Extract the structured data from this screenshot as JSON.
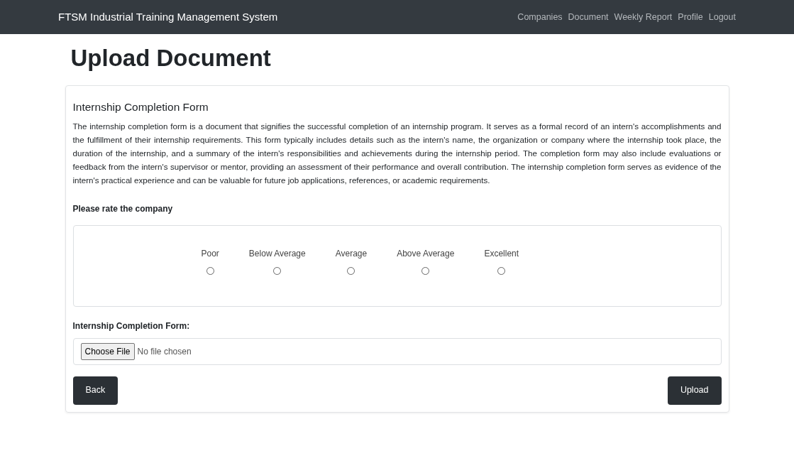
{
  "navbar": {
    "brand": "FTSM Industrial Training Management System",
    "links": [
      {
        "label": "Companies"
      },
      {
        "label": "Document"
      },
      {
        "label": "Weekly Report"
      },
      {
        "label": "Profile"
      },
      {
        "label": "Logout"
      }
    ]
  },
  "page_title": "Upload Document",
  "form": {
    "title": "Internship Completion Form",
    "description": "The internship completion form is a document that signifies the successful completion of an internship program. It serves as a formal record of an intern's accomplishments and the fulfillment of their internship requirements. This form typically includes details such as the intern's name, the organization or company where the internship took place, the duration of the internship, and a summary of the intern's responsibilities and achievements during the internship period. The completion form may also include evaluations or feedback from the intern's supervisor or mentor, providing an assessment of their performance and overall contribution. The internship completion form serves as evidence of the intern's practical experience and can be valuable for future job applications, references, or academic requirements.",
    "rating_label": "Please rate the company",
    "rating_options": [
      {
        "label": "Poor",
        "selected": false
      },
      {
        "label": "Below Average",
        "selected": false
      },
      {
        "label": "Average",
        "selected": false
      },
      {
        "label": "Above Average",
        "selected": false
      },
      {
        "label": "Excellent",
        "selected": false
      }
    ],
    "file_label": "Internship Completion Form:",
    "file_button": "Choose File",
    "file_status": "No file chosen",
    "buttons": [
      {
        "label": "Back"
      },
      {
        "label": "Upload"
      }
    ]
  }
}
